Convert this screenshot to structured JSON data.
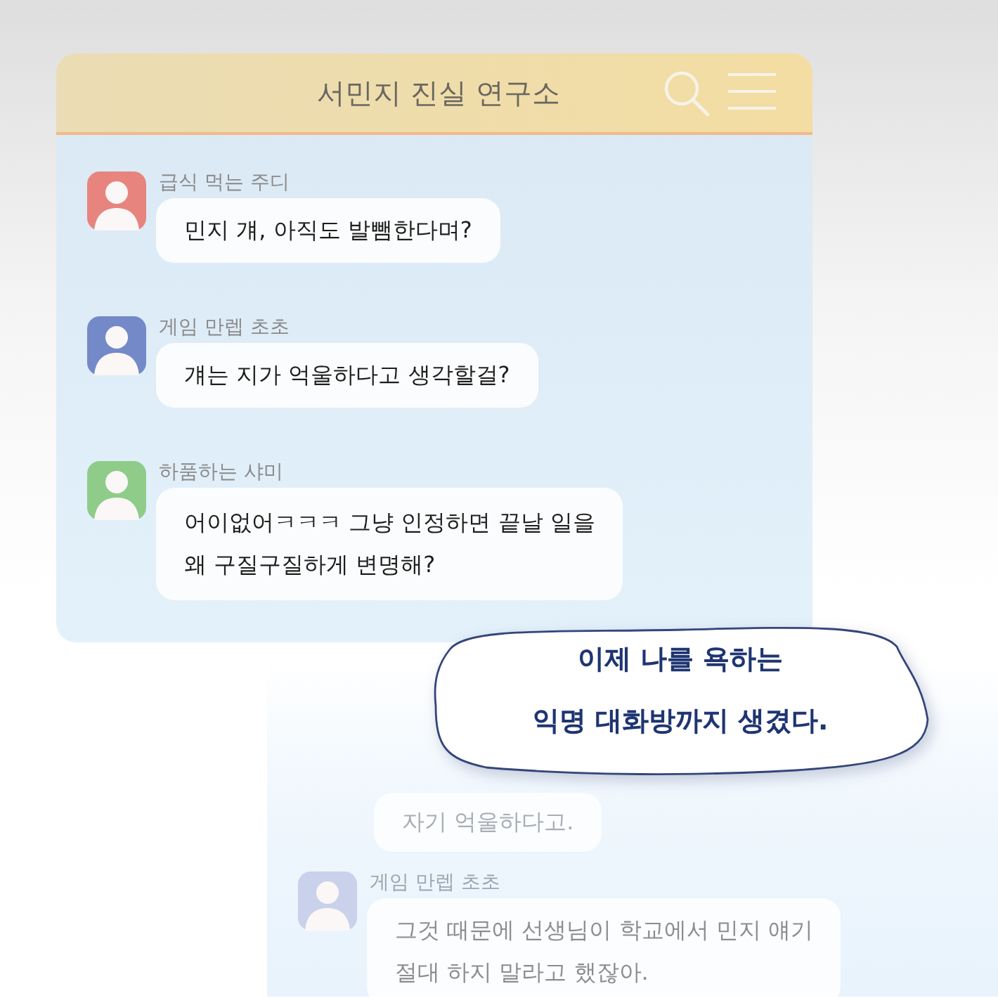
{
  "chat_window": {
    "title": "서민지 진실 연구소",
    "messages": [
      {
        "sender": "급식 먹는 주디",
        "lines": [
          "민지 걔, 아직도 발뺌한다며?"
        ],
        "color": "#e8847e"
      },
      {
        "sender": "게임 만렙 초초",
        "lines": [
          "걔는 지가 억울하다고 생각할걸?"
        ],
        "color": "#7389c8"
      },
      {
        "sender": "하품하는 샤미",
        "lines": [
          "어이없어ㅋㅋㅋ 그냥 인정하면 끝날 일을",
          "왜 구질구질하게 변명해?"
        ],
        "color": "#8fcc8a"
      }
    ]
  },
  "caption": {
    "lines": [
      "이제 나를 욕하는",
      "익명 대화방까지 생겼다."
    ]
  },
  "background_chat": {
    "messages": [
      {
        "kind": "continuation",
        "lines": [
          "자기 억울하다고."
        ]
      },
      {
        "kind": "message",
        "sender": "게임 만렙 초초",
        "lines": [
          "그것 때문에 선생님이 학교에서 민지 얘기",
          "절대 하지 말라고 했잖아."
        ],
        "color": "#c9d2ea"
      }
    ]
  }
}
